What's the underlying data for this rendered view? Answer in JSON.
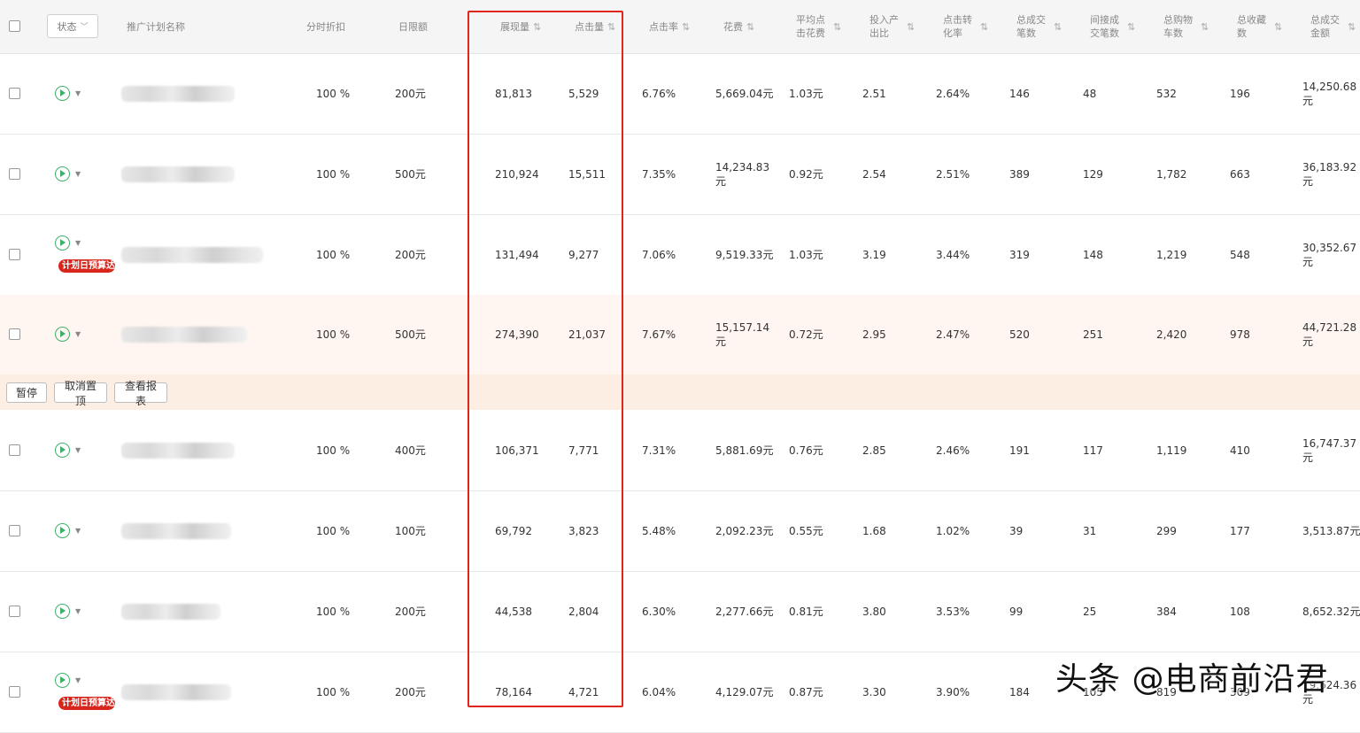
{
  "header": {
    "status_filter": "状态",
    "plan_name": "推广计划名称",
    "time_discount": "分时折扣",
    "daily_limit": "日限额",
    "impressions": "展现量",
    "clicks": "点击量",
    "ctr": "点击率",
    "spend": "花费",
    "avg_cpc": "平均点击花费",
    "roi": "投入产出比",
    "cvr": "点击转化率",
    "total_orders": "总成交笔数",
    "indirect_orders": "间接成交笔数",
    "total_cart": "总购物车数",
    "total_fav": "总收藏数",
    "total_amount": "总成交金额",
    "sort_icon": "⇅"
  },
  "badge_text": "计划日预算达",
  "actions": {
    "pause": "暂停",
    "unpin": "取消置顶",
    "report": "查看报表"
  },
  "rows": [
    {
      "discount": "100 %",
      "daily_limit": "200元",
      "impressions": "81,813",
      "clicks": "5,529",
      "ctr": "6.76%",
      "spend": "5,669.04元",
      "avg_cpc": "1.03元",
      "roi": "2.51",
      "cvr": "2.64%",
      "total_orders": "146",
      "indirect_orders": "48",
      "cart": "532",
      "fav": "196",
      "amount": "14,250.68元",
      "budget_badge": false,
      "highlighted": false
    },
    {
      "discount": "100 %",
      "daily_limit": "500元",
      "impressions": "210,924",
      "clicks": "15,511",
      "ctr": "7.35%",
      "spend": "14,234.83元",
      "avg_cpc": "0.92元",
      "roi": "2.54",
      "cvr": "2.51%",
      "total_orders": "389",
      "indirect_orders": "129",
      "cart": "1,782",
      "fav": "663",
      "amount": "36,183.92元",
      "budget_badge": false,
      "highlighted": false
    },
    {
      "discount": "100 %",
      "daily_limit": "200元",
      "impressions": "131,494",
      "clicks": "9,277",
      "ctr": "7.06%",
      "spend": "9,519.33元",
      "avg_cpc": "1.03元",
      "roi": "3.19",
      "cvr": "3.44%",
      "total_orders": "319",
      "indirect_orders": "148",
      "cart": "1,219",
      "fav": "548",
      "amount": "30,352.67元",
      "budget_badge": true,
      "highlighted": false
    },
    {
      "discount": "100 %",
      "daily_limit": "500元",
      "impressions": "274,390",
      "clicks": "21,037",
      "ctr": "7.67%",
      "spend": "15,157.14元",
      "avg_cpc": "0.72元",
      "roi": "2.95",
      "cvr": "2.47%",
      "total_orders": "520",
      "indirect_orders": "251",
      "cart": "2,420",
      "fav": "978",
      "amount": "44,721.28元",
      "budget_badge": false,
      "highlighted": true
    },
    {
      "discount": "100 %",
      "daily_limit": "400元",
      "impressions": "106,371",
      "clicks": "7,771",
      "ctr": "7.31%",
      "spend": "5,881.69元",
      "avg_cpc": "0.76元",
      "roi": "2.85",
      "cvr": "2.46%",
      "total_orders": "191",
      "indirect_orders": "117",
      "cart": "1,119",
      "fav": "410",
      "amount": "16,747.37元",
      "budget_badge": false,
      "highlighted": false
    },
    {
      "discount": "100 %",
      "daily_limit": "100元",
      "impressions": "69,792",
      "clicks": "3,823",
      "ctr": "5.48%",
      "spend": "2,092.23元",
      "avg_cpc": "0.55元",
      "roi": "1.68",
      "cvr": "1.02%",
      "total_orders": "39",
      "indirect_orders": "31",
      "cart": "299",
      "fav": "177",
      "amount": "3,513.87元",
      "budget_badge": false,
      "highlighted": false
    },
    {
      "discount": "100 %",
      "daily_limit": "200元",
      "impressions": "44,538",
      "clicks": "2,804",
      "ctr": "6.30%",
      "spend": "2,277.66元",
      "avg_cpc": "0.81元",
      "roi": "3.80",
      "cvr": "3.53%",
      "total_orders": "99",
      "indirect_orders": "25",
      "cart": "384",
      "fav": "108",
      "amount": "8,652.32元",
      "budget_badge": false,
      "highlighted": false
    },
    {
      "discount": "100 %",
      "daily_limit": "200元",
      "impressions": "78,164",
      "clicks": "4,721",
      "ctr": "6.04%",
      "spend": "4,129.07元",
      "avg_cpc": "0.87元",
      "roi": "3.30",
      "cvr": "3.90%",
      "total_orders": "184",
      "indirect_orders": "105",
      "cart": "819",
      "fav": "309",
      "amount": "19,624.36元",
      "budget_badge": true,
      "highlighted": false
    }
  ],
  "watermark": "头条 @电商前沿君",
  "colors": {
    "highlight_box": "#e0261a",
    "play_icon": "#3eb06a",
    "badge": "#d9261c",
    "highlight_row": "#fff6f1"
  }
}
